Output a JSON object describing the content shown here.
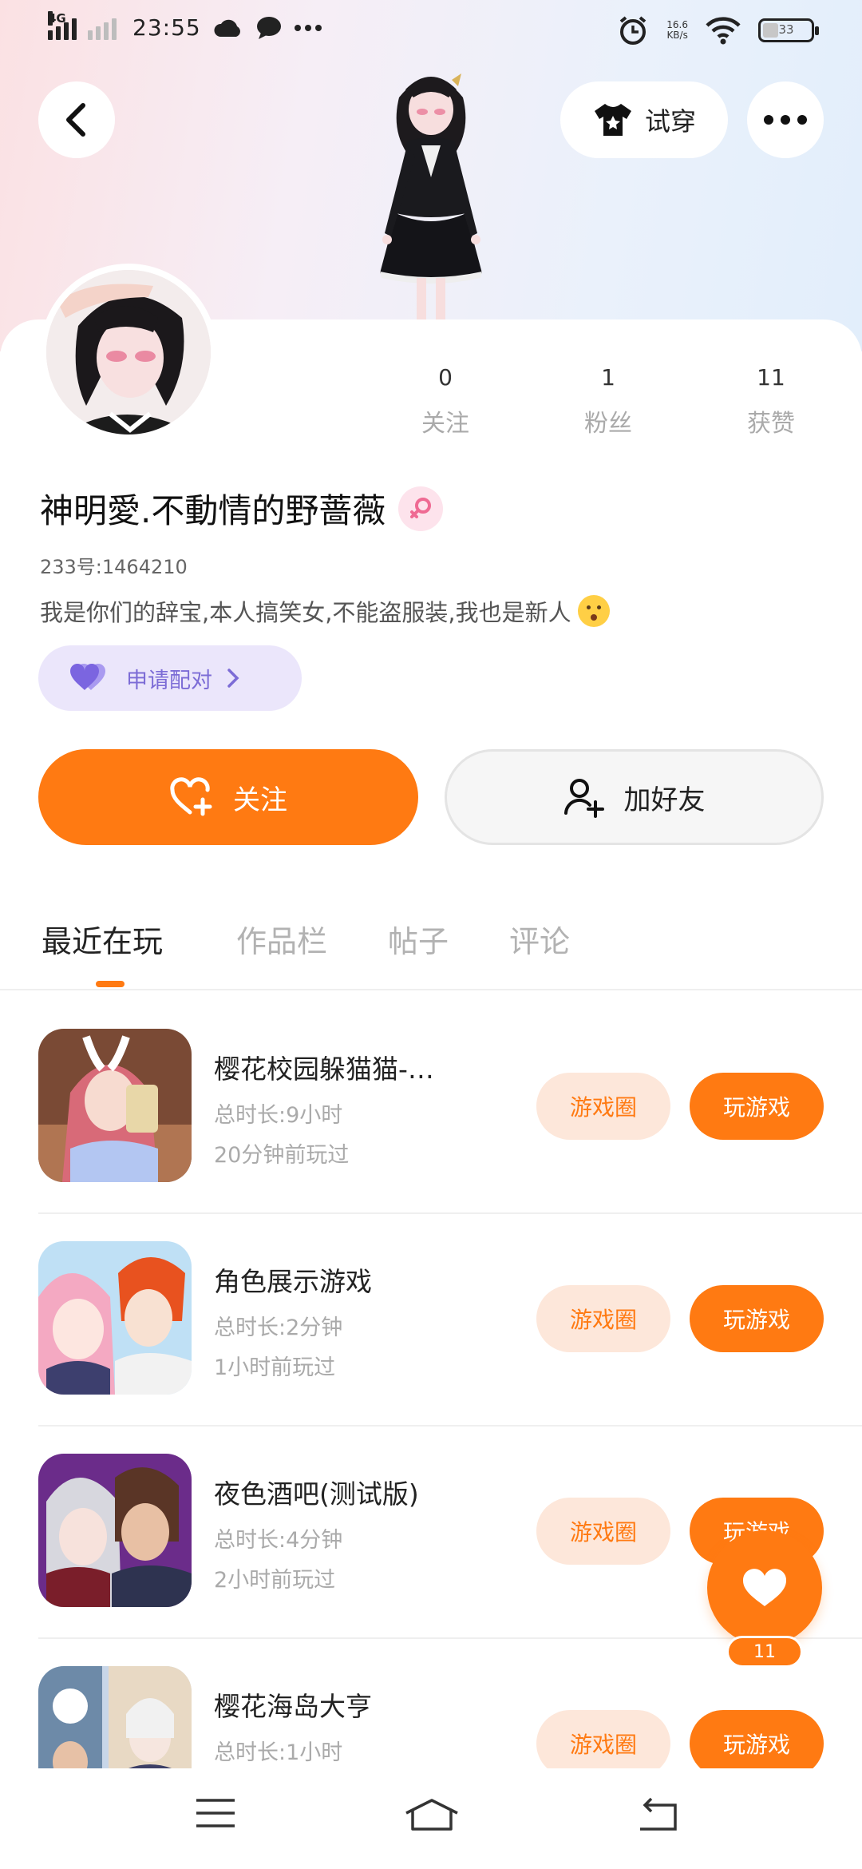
{
  "status_bar": {
    "network": "4G",
    "time": "23:55",
    "speed_value": "16.6",
    "speed_unit": "KB/s",
    "battery": "33",
    "battery_level": 0.33
  },
  "header": {
    "try_on_label": "试穿"
  },
  "profile": {
    "stats": [
      {
        "value": "0",
        "label": "关注"
      },
      {
        "value": "1",
        "label": "粉丝"
      },
      {
        "value": "11",
        "label": "获赞"
      }
    ],
    "name": "神明愛.不動情的野蔷薇",
    "uid": "233号:1464210",
    "bio": "我是你们的辞宝,本人搞笑女,不能盗服装,我也是新人",
    "pair_label": "申请配对",
    "follow_label": "关注",
    "add_friend_label": "加好友"
  },
  "tabs": [
    {
      "label": "最近在玩",
      "active": true
    },
    {
      "label": "作品栏",
      "active": false
    },
    {
      "label": "帖子",
      "active": false
    },
    {
      "label": "评论",
      "active": false
    }
  ],
  "games": [
    {
      "title": "樱花校园躲猫猫-…",
      "duration": "总时长:9小时",
      "last_played": "20分钟前玩过",
      "circle_label": "游戏圈",
      "play_label": "玩游戏"
    },
    {
      "title": "角色展示游戏",
      "duration": "总时长:2分钟",
      "last_played": "1小时前玩过",
      "circle_label": "游戏圈",
      "play_label": "玩游戏"
    },
    {
      "title": "夜色酒吧(测试版)",
      "duration": "总时长:4分钟",
      "last_played": "2小时前玩过",
      "circle_label": "游戏圈",
      "play_label": "玩游戏"
    },
    {
      "title": "樱花海岛大亨",
      "duration": "总时长:1小时",
      "last_played": "",
      "circle_label": "游戏圈",
      "play_label": "玩游戏"
    }
  ],
  "like_fab": {
    "count": "11"
  },
  "colors": {
    "accent": "#ff7a12",
    "pair_bg": "#ebe6fb",
    "pair_text": "#7c6cd6"
  },
  "icons": [
    "back-icon",
    "tshirt-icon",
    "more-icon",
    "heart-plus-icon",
    "person-plus-icon",
    "chevron-right-icon",
    "heart-icon",
    "menu-icon",
    "home-icon",
    "return-icon"
  ]
}
